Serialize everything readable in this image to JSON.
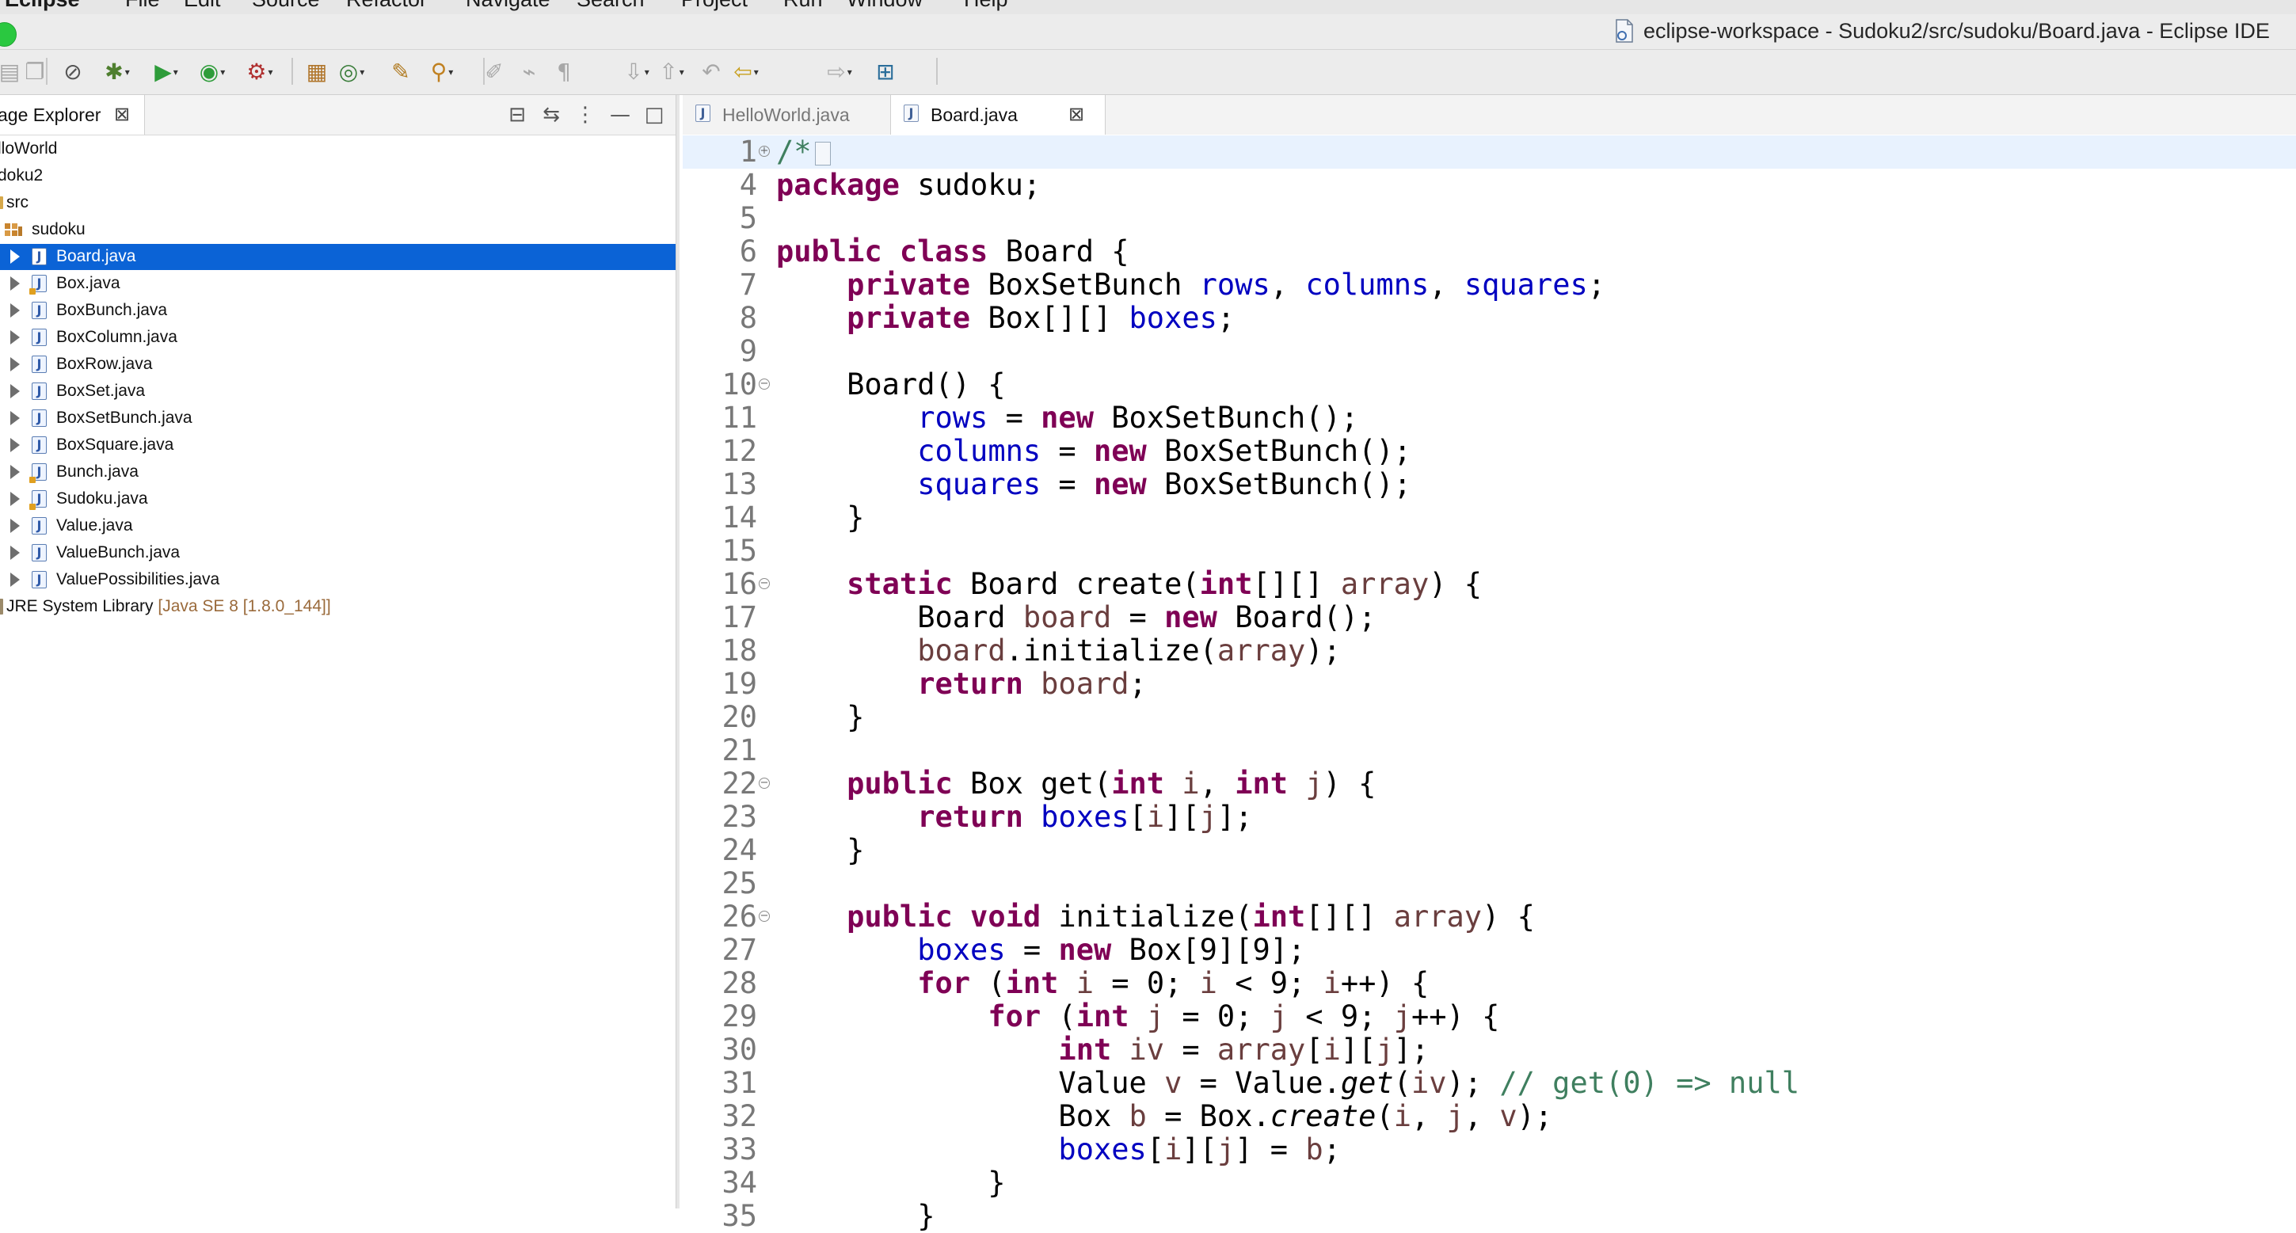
{
  "menubar": {
    "items": [
      "Eclipse",
      "File",
      "Edit",
      "Source",
      "Refactor",
      "Navigate",
      "Search",
      "Project",
      "Run",
      "Window",
      "Help"
    ]
  },
  "window": {
    "title": "eclipse-workspace - Sudoku2/src/sudoku/Board.java - Eclipse IDE"
  },
  "package_explorer": {
    "tab_label": "age Explorer",
    "tree": [
      {
        "label": "lloWorld"
      },
      {
        "label": "doku2"
      },
      {
        "label": "src"
      },
      {
        "label": "sudoku"
      },
      {
        "label": "Board.java",
        "selected": true
      },
      {
        "label": "Box.java",
        "warning": true
      },
      {
        "label": "BoxBunch.java"
      },
      {
        "label": "BoxColumn.java"
      },
      {
        "label": "BoxRow.java"
      },
      {
        "label": "BoxSet.java"
      },
      {
        "label": "BoxSetBunch.java"
      },
      {
        "label": "BoxSquare.java"
      },
      {
        "label": "Bunch.java",
        "warning": true
      },
      {
        "label": "Sudoku.java",
        "warning": true
      },
      {
        "label": "Value.java"
      },
      {
        "label": "ValueBunch.java"
      },
      {
        "label": "ValuePossibilities.java"
      },
      {
        "label": "JRE System Library",
        "suffix": "[Java SE 8 [1.8.0_144]]"
      }
    ]
  },
  "editor": {
    "tabs": [
      {
        "label": "HelloWorld.java",
        "active": false
      },
      {
        "label": "Board.java",
        "active": true
      }
    ],
    "lines": [
      {
        "num": "1",
        "fold": "+",
        "current": true,
        "segs": [
          {
            "c": "cm",
            "t": "/*"
          }
        ],
        "folded": true
      },
      {
        "num": "4",
        "segs": [
          {
            "c": "kw",
            "t": "package"
          },
          {
            "c": "",
            "t": " sudoku;"
          }
        ]
      },
      {
        "num": "5",
        "segs": []
      },
      {
        "num": "6",
        "segs": [
          {
            "c": "kw",
            "t": "public class"
          },
          {
            "c": "",
            "t": " Board {"
          }
        ]
      },
      {
        "num": "7",
        "segs": [
          {
            "c": "",
            "t": "    "
          },
          {
            "c": "kw",
            "t": "private"
          },
          {
            "c": "",
            "t": " BoxSetBunch "
          },
          {
            "c": "fd",
            "t": "rows"
          },
          {
            "c": "",
            "t": ", "
          },
          {
            "c": "fd",
            "t": "columns"
          },
          {
            "c": "",
            "t": ", "
          },
          {
            "c": "fd",
            "t": "squares"
          },
          {
            "c": "",
            "t": ";"
          }
        ]
      },
      {
        "num": "8",
        "segs": [
          {
            "c": "",
            "t": "    "
          },
          {
            "c": "kw",
            "t": "private"
          },
          {
            "c": "",
            "t": " Box[][] "
          },
          {
            "c": "fd",
            "t": "boxes"
          },
          {
            "c": "",
            "t": ";"
          }
        ]
      },
      {
        "num": "9",
        "segs": []
      },
      {
        "num": "10",
        "fold": "-",
        "segs": [
          {
            "c": "",
            "t": "    Board() {"
          }
        ]
      },
      {
        "num": "11",
        "segs": [
          {
            "c": "",
            "t": "        "
          },
          {
            "c": "fd",
            "t": "rows"
          },
          {
            "c": "",
            "t": " = "
          },
          {
            "c": "kw",
            "t": "new"
          },
          {
            "c": "",
            "t": " BoxSetBunch();"
          }
        ]
      },
      {
        "num": "12",
        "segs": [
          {
            "c": "",
            "t": "        "
          },
          {
            "c": "fd",
            "t": "columns"
          },
          {
            "c": "",
            "t": " = "
          },
          {
            "c": "kw",
            "t": "new"
          },
          {
            "c": "",
            "t": " BoxSetBunch();"
          }
        ]
      },
      {
        "num": "13",
        "segs": [
          {
            "c": "",
            "t": "        "
          },
          {
            "c": "fd",
            "t": "squares"
          },
          {
            "c": "",
            "t": " = "
          },
          {
            "c": "kw",
            "t": "new"
          },
          {
            "c": "",
            "t": " BoxSetBunch();"
          }
        ]
      },
      {
        "num": "14",
        "segs": [
          {
            "c": "",
            "t": "    }"
          }
        ]
      },
      {
        "num": "15",
        "segs": []
      },
      {
        "num": "16",
        "fold": "-",
        "segs": [
          {
            "c": "",
            "t": "    "
          },
          {
            "c": "kw",
            "t": "static"
          },
          {
            "c": "",
            "t": " Board create("
          },
          {
            "c": "kw",
            "t": "int"
          },
          {
            "c": "",
            "t": "[][] "
          },
          {
            "c": "pm",
            "t": "array"
          },
          {
            "c": "",
            "t": ") {"
          }
        ]
      },
      {
        "num": "17",
        "segs": [
          {
            "c": "",
            "t": "        Board "
          },
          {
            "c": "pm",
            "t": "board"
          },
          {
            "c": "",
            "t": " = "
          },
          {
            "c": "kw",
            "t": "new"
          },
          {
            "c": "",
            "t": " Board();"
          }
        ]
      },
      {
        "num": "18",
        "segs": [
          {
            "c": "",
            "t": "        "
          },
          {
            "c": "pm",
            "t": "board"
          },
          {
            "c": "",
            "t": ".initialize("
          },
          {
            "c": "pm",
            "t": "array"
          },
          {
            "c": "",
            "t": ");"
          }
        ]
      },
      {
        "num": "19",
        "segs": [
          {
            "c": "",
            "t": "        "
          },
          {
            "c": "kw",
            "t": "return"
          },
          {
            "c": "",
            "t": " "
          },
          {
            "c": "pm",
            "t": "board"
          },
          {
            "c": "",
            "t": ";"
          }
        ]
      },
      {
        "num": "20",
        "segs": [
          {
            "c": "",
            "t": "    }"
          }
        ]
      },
      {
        "num": "21",
        "segs": []
      },
      {
        "num": "22",
        "fold": "-",
        "segs": [
          {
            "c": "",
            "t": "    "
          },
          {
            "c": "kw",
            "t": "public"
          },
          {
            "c": "",
            "t": " Box get("
          },
          {
            "c": "kw",
            "t": "int"
          },
          {
            "c": "",
            "t": " "
          },
          {
            "c": "pm",
            "t": "i"
          },
          {
            "c": "",
            "t": ", "
          },
          {
            "c": "kw",
            "t": "int"
          },
          {
            "c": "",
            "t": " "
          },
          {
            "c": "pm",
            "t": "j"
          },
          {
            "c": "",
            "t": ") {"
          }
        ]
      },
      {
        "num": "23",
        "segs": [
          {
            "c": "",
            "t": "        "
          },
          {
            "c": "kw",
            "t": "return"
          },
          {
            "c": "",
            "t": " "
          },
          {
            "c": "fd",
            "t": "boxes"
          },
          {
            "c": "",
            "t": "["
          },
          {
            "c": "pm",
            "t": "i"
          },
          {
            "c": "",
            "t": "]["
          },
          {
            "c": "pm",
            "t": "j"
          },
          {
            "c": "",
            "t": "];"
          }
        ]
      },
      {
        "num": "24",
        "segs": [
          {
            "c": "",
            "t": "    }"
          }
        ]
      },
      {
        "num": "25",
        "segs": []
      },
      {
        "num": "26",
        "fold": "-",
        "segs": [
          {
            "c": "",
            "t": "    "
          },
          {
            "c": "kw",
            "t": "public void"
          },
          {
            "c": "",
            "t": " initialize("
          },
          {
            "c": "kw",
            "t": "int"
          },
          {
            "c": "",
            "t": "[][] "
          },
          {
            "c": "pm",
            "t": "array"
          },
          {
            "c": "",
            "t": ") {"
          }
        ]
      },
      {
        "num": "27",
        "segs": [
          {
            "c": "",
            "t": "        "
          },
          {
            "c": "fd",
            "t": "boxes"
          },
          {
            "c": "",
            "t": " = "
          },
          {
            "c": "kw",
            "t": "new"
          },
          {
            "c": "",
            "t": " Box[9][9];"
          }
        ]
      },
      {
        "num": "28",
        "segs": [
          {
            "c": "",
            "t": "        "
          },
          {
            "c": "kw",
            "t": "for"
          },
          {
            "c": "",
            "t": " ("
          },
          {
            "c": "kw",
            "t": "int"
          },
          {
            "c": "",
            "t": " "
          },
          {
            "c": "pm",
            "t": "i"
          },
          {
            "c": "",
            "t": " = 0; "
          },
          {
            "c": "pm",
            "t": "i"
          },
          {
            "c": "",
            "t": " < 9; "
          },
          {
            "c": "pm",
            "t": "i"
          },
          {
            "c": "",
            "t": "++) {"
          }
        ]
      },
      {
        "num": "29",
        "segs": [
          {
            "c": "",
            "t": "            "
          },
          {
            "c": "kw",
            "t": "for"
          },
          {
            "c": "",
            "t": " ("
          },
          {
            "c": "kw",
            "t": "int"
          },
          {
            "c": "",
            "t": " "
          },
          {
            "c": "pm",
            "t": "j"
          },
          {
            "c": "",
            "t": " = 0; "
          },
          {
            "c": "pm",
            "t": "j"
          },
          {
            "c": "",
            "t": " < 9; "
          },
          {
            "c": "pm",
            "t": "j"
          },
          {
            "c": "",
            "t": "++) {"
          }
        ]
      },
      {
        "num": "30",
        "segs": [
          {
            "c": "",
            "t": "                "
          },
          {
            "c": "kw",
            "t": "int"
          },
          {
            "c": "",
            "t": " "
          },
          {
            "c": "pm",
            "t": "iv"
          },
          {
            "c": "",
            "t": " = "
          },
          {
            "c": "pm",
            "t": "array"
          },
          {
            "c": "",
            "t": "["
          },
          {
            "c": "pm",
            "t": "i"
          },
          {
            "c": "",
            "t": "]["
          },
          {
            "c": "pm",
            "t": "j"
          },
          {
            "c": "",
            "t": "];"
          }
        ]
      },
      {
        "num": "31",
        "segs": [
          {
            "c": "",
            "t": "                Value "
          },
          {
            "c": "pm",
            "t": "v"
          },
          {
            "c": "",
            "t": " = Value."
          },
          {
            "c": "st",
            "t": "get"
          },
          {
            "c": "",
            "t": "("
          },
          {
            "c": "pm",
            "t": "iv"
          },
          {
            "c": "",
            "t": "); "
          },
          {
            "c": "cm",
            "t": "// get(0) => null"
          }
        ]
      },
      {
        "num": "32",
        "segs": [
          {
            "c": "",
            "t": "                Box "
          },
          {
            "c": "pm",
            "t": "b"
          },
          {
            "c": "",
            "t": " = Box."
          },
          {
            "c": "st",
            "t": "create"
          },
          {
            "c": "",
            "t": "("
          },
          {
            "c": "pm",
            "t": "i"
          },
          {
            "c": "",
            "t": ", "
          },
          {
            "c": "pm",
            "t": "j"
          },
          {
            "c": "",
            "t": ", "
          },
          {
            "c": "pm",
            "t": "v"
          },
          {
            "c": "",
            "t": ");"
          }
        ]
      },
      {
        "num": "33",
        "segs": [
          {
            "c": "",
            "t": "                "
          },
          {
            "c": "fd",
            "t": "boxes"
          },
          {
            "c": "",
            "t": "["
          },
          {
            "c": "pm",
            "t": "i"
          },
          {
            "c": "",
            "t": "]["
          },
          {
            "c": "pm",
            "t": "j"
          },
          {
            "c": "",
            "t": "] = "
          },
          {
            "c": "pm",
            "t": "b"
          },
          {
            "c": "",
            "t": ";"
          }
        ]
      },
      {
        "num": "34",
        "segs": [
          {
            "c": "",
            "t": "            }"
          }
        ]
      },
      {
        "num": "35",
        "segs": [
          {
            "c": "",
            "t": "        }"
          }
        ]
      }
    ]
  },
  "colors": {
    "selection": "#0b63d6",
    "keyword": "#7f0055",
    "field": "#0000c0",
    "local": "#6a3e3e",
    "comment": "#3f7f5f",
    "current_line": "#e8f2fe"
  },
  "icons": {
    "title": "java-file-icon",
    "toolbar": [
      "save-icon",
      "save-all-icon",
      "skip-breakpoints-icon",
      "debug-icon",
      "run-icon",
      "coverage-icon",
      "external-tools-icon",
      "new-java-package-icon",
      "new-java-class-icon",
      "open-type-icon",
      "search-icon",
      "toggle-mark-occurrences-icon",
      "toggle-breadcrumb-icon",
      "show-whitespace-icon",
      "next-annotation-icon",
      "previous-annotation-icon",
      "last-edit-location-icon",
      "back-icon",
      "forward-icon",
      "open-perspective-icon"
    ]
  }
}
